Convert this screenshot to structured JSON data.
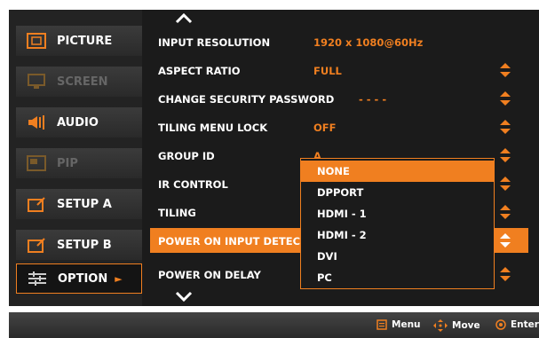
{
  "sidebar": {
    "items": [
      {
        "label": "PICTURE",
        "icon": "picture-icon"
      },
      {
        "label": "SCREEN",
        "icon": "screen-icon"
      },
      {
        "label": "AUDIO",
        "icon": "audio-icon"
      },
      {
        "label": "PIP",
        "icon": "pip-icon"
      },
      {
        "label": "SETUP A",
        "icon": "setup-a-icon"
      },
      {
        "label": "SETUP B",
        "icon": "setup-b-icon"
      },
      {
        "label": "OPTION",
        "icon": "option-icon",
        "arrow": "►"
      }
    ]
  },
  "main": {
    "rows": [
      {
        "label": "INPUT RESOLUTION",
        "value": "1920 x 1080@60Hz"
      },
      {
        "label": "ASPECT RATIO",
        "value": "FULL"
      },
      {
        "label": "CHANGE SECURITY PASSWORD",
        "value": "- - - -"
      },
      {
        "label": "TILING MENU LOCK",
        "value": "OFF"
      },
      {
        "label": "GROUP ID",
        "value": "A"
      },
      {
        "label": "IR CONTROL",
        "value": ""
      },
      {
        "label": "TILING",
        "value": ""
      },
      {
        "label": "POWER ON INPUT DETECTION",
        "value": ""
      },
      {
        "label": "POWER ON DELAY",
        "value": ""
      }
    ]
  },
  "dropdown": {
    "options": [
      "NONE",
      "DPPORT",
      "HDMI - 1",
      "HDMI - 2",
      "DVI",
      "PC"
    ],
    "selected_index": 0
  },
  "footer": {
    "menu_label": "Menu",
    "move_label": "Move",
    "enter_label": "Enter"
  },
  "colors": {
    "accent": "#f07f20",
    "background": "#1b1b1b",
    "text": "#ffffff"
  }
}
